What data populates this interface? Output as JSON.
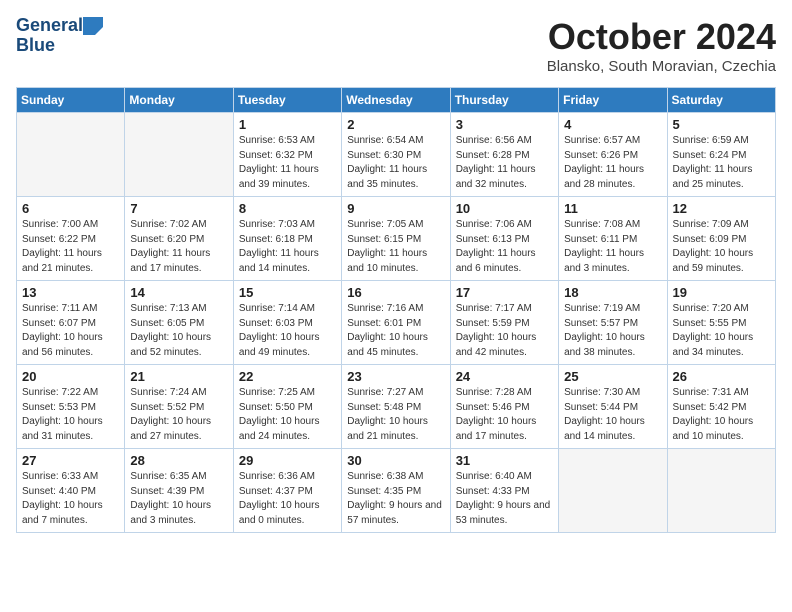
{
  "header": {
    "logo_line1": "General",
    "logo_line2": "Blue",
    "month": "October 2024",
    "location": "Blansko, South Moravian, Czechia"
  },
  "columns": [
    "Sunday",
    "Monday",
    "Tuesday",
    "Wednesday",
    "Thursday",
    "Friday",
    "Saturday"
  ],
  "weeks": [
    [
      {
        "day": "",
        "info": ""
      },
      {
        "day": "",
        "info": ""
      },
      {
        "day": "1",
        "info": "Sunrise: 6:53 AM\nSunset: 6:32 PM\nDaylight: 11 hours and 39 minutes."
      },
      {
        "day": "2",
        "info": "Sunrise: 6:54 AM\nSunset: 6:30 PM\nDaylight: 11 hours and 35 minutes."
      },
      {
        "day": "3",
        "info": "Sunrise: 6:56 AM\nSunset: 6:28 PM\nDaylight: 11 hours and 32 minutes."
      },
      {
        "day": "4",
        "info": "Sunrise: 6:57 AM\nSunset: 6:26 PM\nDaylight: 11 hours and 28 minutes."
      },
      {
        "day": "5",
        "info": "Sunrise: 6:59 AM\nSunset: 6:24 PM\nDaylight: 11 hours and 25 minutes."
      }
    ],
    [
      {
        "day": "6",
        "info": "Sunrise: 7:00 AM\nSunset: 6:22 PM\nDaylight: 11 hours and 21 minutes."
      },
      {
        "day": "7",
        "info": "Sunrise: 7:02 AM\nSunset: 6:20 PM\nDaylight: 11 hours and 17 minutes."
      },
      {
        "day": "8",
        "info": "Sunrise: 7:03 AM\nSunset: 6:18 PM\nDaylight: 11 hours and 14 minutes."
      },
      {
        "day": "9",
        "info": "Sunrise: 7:05 AM\nSunset: 6:15 PM\nDaylight: 11 hours and 10 minutes."
      },
      {
        "day": "10",
        "info": "Sunrise: 7:06 AM\nSunset: 6:13 PM\nDaylight: 11 hours and 6 minutes."
      },
      {
        "day": "11",
        "info": "Sunrise: 7:08 AM\nSunset: 6:11 PM\nDaylight: 11 hours and 3 minutes."
      },
      {
        "day": "12",
        "info": "Sunrise: 7:09 AM\nSunset: 6:09 PM\nDaylight: 10 hours and 59 minutes."
      }
    ],
    [
      {
        "day": "13",
        "info": "Sunrise: 7:11 AM\nSunset: 6:07 PM\nDaylight: 10 hours and 56 minutes."
      },
      {
        "day": "14",
        "info": "Sunrise: 7:13 AM\nSunset: 6:05 PM\nDaylight: 10 hours and 52 minutes."
      },
      {
        "day": "15",
        "info": "Sunrise: 7:14 AM\nSunset: 6:03 PM\nDaylight: 10 hours and 49 minutes."
      },
      {
        "day": "16",
        "info": "Sunrise: 7:16 AM\nSunset: 6:01 PM\nDaylight: 10 hours and 45 minutes."
      },
      {
        "day": "17",
        "info": "Sunrise: 7:17 AM\nSunset: 5:59 PM\nDaylight: 10 hours and 42 minutes."
      },
      {
        "day": "18",
        "info": "Sunrise: 7:19 AM\nSunset: 5:57 PM\nDaylight: 10 hours and 38 minutes."
      },
      {
        "day": "19",
        "info": "Sunrise: 7:20 AM\nSunset: 5:55 PM\nDaylight: 10 hours and 34 minutes."
      }
    ],
    [
      {
        "day": "20",
        "info": "Sunrise: 7:22 AM\nSunset: 5:53 PM\nDaylight: 10 hours and 31 minutes."
      },
      {
        "day": "21",
        "info": "Sunrise: 7:24 AM\nSunset: 5:52 PM\nDaylight: 10 hours and 27 minutes."
      },
      {
        "day": "22",
        "info": "Sunrise: 7:25 AM\nSunset: 5:50 PM\nDaylight: 10 hours and 24 minutes."
      },
      {
        "day": "23",
        "info": "Sunrise: 7:27 AM\nSunset: 5:48 PM\nDaylight: 10 hours and 21 minutes."
      },
      {
        "day": "24",
        "info": "Sunrise: 7:28 AM\nSunset: 5:46 PM\nDaylight: 10 hours and 17 minutes."
      },
      {
        "day": "25",
        "info": "Sunrise: 7:30 AM\nSunset: 5:44 PM\nDaylight: 10 hours and 14 minutes."
      },
      {
        "day": "26",
        "info": "Sunrise: 7:31 AM\nSunset: 5:42 PM\nDaylight: 10 hours and 10 minutes."
      }
    ],
    [
      {
        "day": "27",
        "info": "Sunrise: 6:33 AM\nSunset: 4:40 PM\nDaylight: 10 hours and 7 minutes."
      },
      {
        "day": "28",
        "info": "Sunrise: 6:35 AM\nSunset: 4:39 PM\nDaylight: 10 hours and 3 minutes."
      },
      {
        "day": "29",
        "info": "Sunrise: 6:36 AM\nSunset: 4:37 PM\nDaylight: 10 hours and 0 minutes."
      },
      {
        "day": "30",
        "info": "Sunrise: 6:38 AM\nSunset: 4:35 PM\nDaylight: 9 hours and 57 minutes."
      },
      {
        "day": "31",
        "info": "Sunrise: 6:40 AM\nSunset: 4:33 PM\nDaylight: 9 hours and 53 minutes."
      },
      {
        "day": "",
        "info": ""
      },
      {
        "day": "",
        "info": ""
      }
    ]
  ]
}
